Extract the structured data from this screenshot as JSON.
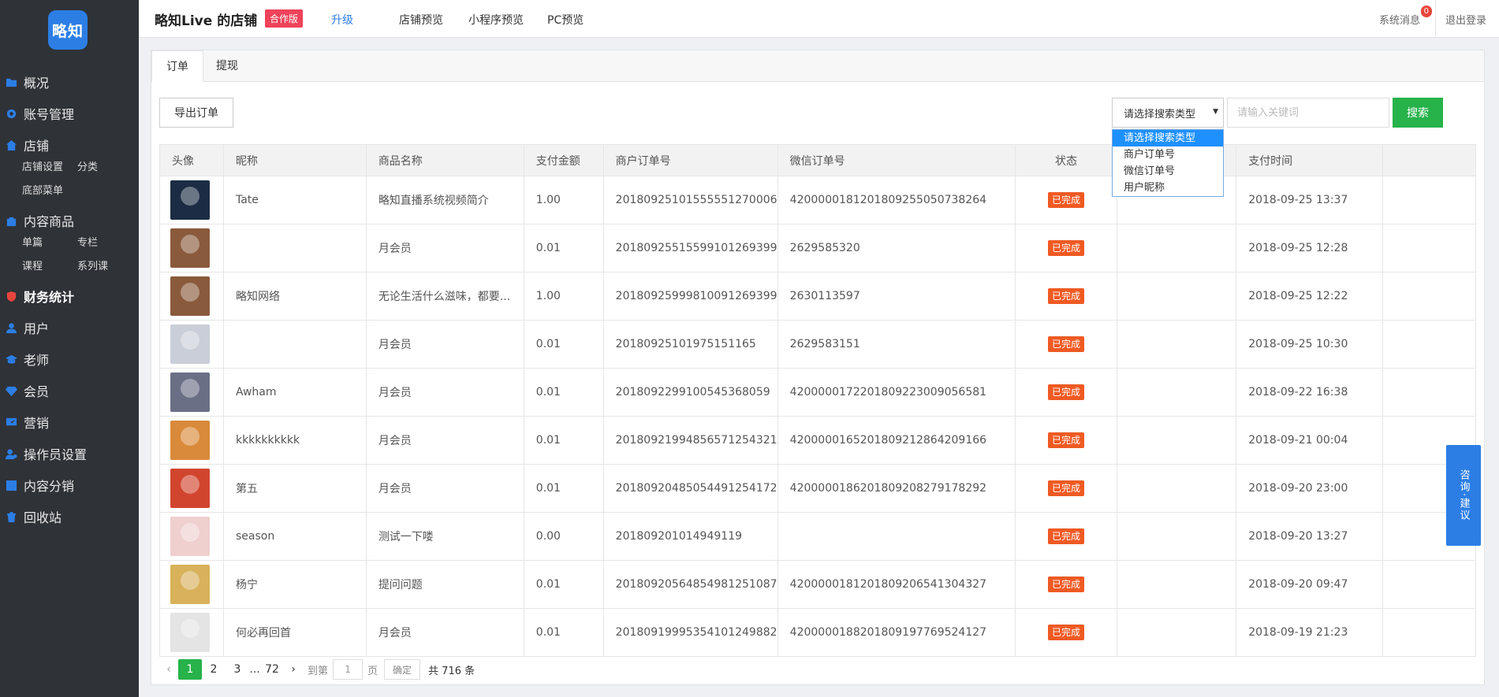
{
  "sidebar": {
    "logo": "略知",
    "items": [
      {
        "label": "概况",
        "icon": "folder-icon"
      },
      {
        "label": "账号管理",
        "icon": "gear-icon"
      },
      {
        "label": "店铺",
        "icon": "home-icon",
        "sub": [
          "店铺设置",
          "分类",
          "底部菜单"
        ]
      },
      {
        "label": "内容商品",
        "icon": "bag-icon",
        "sub": [
          "单篇",
          "专栏",
          "课程",
          "系列课"
        ]
      },
      {
        "label": "财务统计",
        "icon": "shield-icon",
        "active": true
      },
      {
        "label": "用户",
        "icon": "user-icon"
      },
      {
        "label": "老师",
        "icon": "graduation-cap-icon"
      },
      {
        "label": "会员",
        "icon": "diamond-icon"
      },
      {
        "label": "营销",
        "icon": "chart-icon"
      },
      {
        "label": "操作员设置",
        "icon": "operator-icon"
      },
      {
        "label": "内容分销",
        "icon": "share-icon"
      },
      {
        "label": "回收站",
        "icon": "trash-icon"
      }
    ]
  },
  "header": {
    "title": "略知Live 的店铺",
    "badge": "合作版",
    "upgrade": "升级",
    "links": [
      "店铺预览",
      "小程序预览",
      "PC预览"
    ],
    "sys_msg": "系统消息",
    "msg_count": "0",
    "logout": "退出登录"
  },
  "tabs": [
    "订单",
    "提现"
  ],
  "toolbar": {
    "export": "导出订单",
    "select_value": "请选择搜索类型",
    "select_options": [
      "请选择搜索类型",
      "商户订单号",
      "微信订单号",
      "用户昵称"
    ],
    "search_placeholder": "请输入关键词",
    "search_button": "搜索"
  },
  "table": {
    "headers": [
      "头像",
      "昵称",
      "商品名称",
      "支付金额",
      "商户订单号",
      "微信订单号",
      "状态",
      "",
      "支付时间"
    ],
    "rows": [
      {
        "avatar": "#1c2c44",
        "nick": "Tate",
        "product": "略知直播系统视频简介",
        "amount": "1.00",
        "merchant_no": "20180925101555551270006",
        "wechat_no": "4200000181201809255050738264",
        "status": "已完成",
        "time": "2018-09-25 13:37"
      },
      {
        "avatar": "#8a5a3c",
        "nick": "",
        "product": "月会员",
        "amount": "0.01",
        "merchant_no": "20180925515599101269399",
        "wechat_no": "2629585320",
        "status": "已完成",
        "time": "2018-09-25 12:28"
      },
      {
        "avatar": "#8a5a3c",
        "nick": "略知网络",
        "product": "无论生活什么滋味，都要...",
        "amount": "1.00",
        "merchant_no": "20180925999810091269399",
        "wechat_no": "2630113597",
        "status": "已完成",
        "time": "2018-09-25 12:22"
      },
      {
        "avatar": "#c9ced8",
        "nick": "",
        "product": "月会员",
        "amount": "0.01",
        "merchant_no": "2018092510197515116​5",
        "wechat_no": "2629583151",
        "status": "已完成",
        "time": "2018-09-25 10:30"
      },
      {
        "avatar": "#6b6f86",
        "nick": "Awham",
        "product": "月会员",
        "amount": "0.01",
        "merchant_no": "20180922991005453680​59",
        "wechat_no": "4200000172201809223009056581",
        "status": "已完成",
        "time": "2018-09-22 16:38"
      },
      {
        "avatar": "#d98a3a",
        "nick": "kkkkkkkkkk",
        "product": "月会员",
        "amount": "0.01",
        "merchant_no": "20180921994856571254321",
        "wechat_no": "4200000165201809212864209166",
        "status": "已完成",
        "time": "2018-09-21 00:04"
      },
      {
        "avatar": "#d1452e",
        "nick": "第五",
        "product": "月会员",
        "amount": "0.01",
        "merchant_no": "20180920485054491254172",
        "wechat_no": "4200000186201809208279178292",
        "status": "已完成",
        "time": "2018-09-20 23:00"
      },
      {
        "avatar": "#f0cfcf",
        "nick": "season",
        "product": "测试一下喽",
        "amount": "0.00",
        "merchant_no": "201809201014949119",
        "wechat_no": "",
        "status": "已完成",
        "time": "2018-09-20 13:27"
      },
      {
        "avatar": "#d8b15a",
        "nick": "杨宁",
        "product": "提问问题",
        "amount": "0.01",
        "merchant_no": "20180920564854981251087",
        "wechat_no": "4200000181201809206541304327",
        "status": "已完成",
        "time": "2018-09-20 09:47"
      },
      {
        "avatar": "#e4e4e4",
        "nick": "何必再回首",
        "product": "月会员",
        "amount": "0.01",
        "merchant_no": "20180919995354101249882",
        "wechat_no": "4200000188201809197769524127",
        "status": "已完成",
        "time": "2018-09-19 21:23"
      }
    ]
  },
  "pager": {
    "prev": "‹",
    "pages": [
      "1",
      "2",
      "3"
    ],
    "ellipsis": "...",
    "last": "72",
    "next": "›",
    "goto_label": "到第",
    "goto_value": "1",
    "page_unit": "页",
    "confirm": "确定",
    "total": "共 716 条"
  },
  "consult": "咨询·建议",
  "colors": {
    "primary": "#2c7ee5",
    "success": "#27b24a",
    "status": "#f05a23",
    "sidebar": "#2f3237"
  }
}
